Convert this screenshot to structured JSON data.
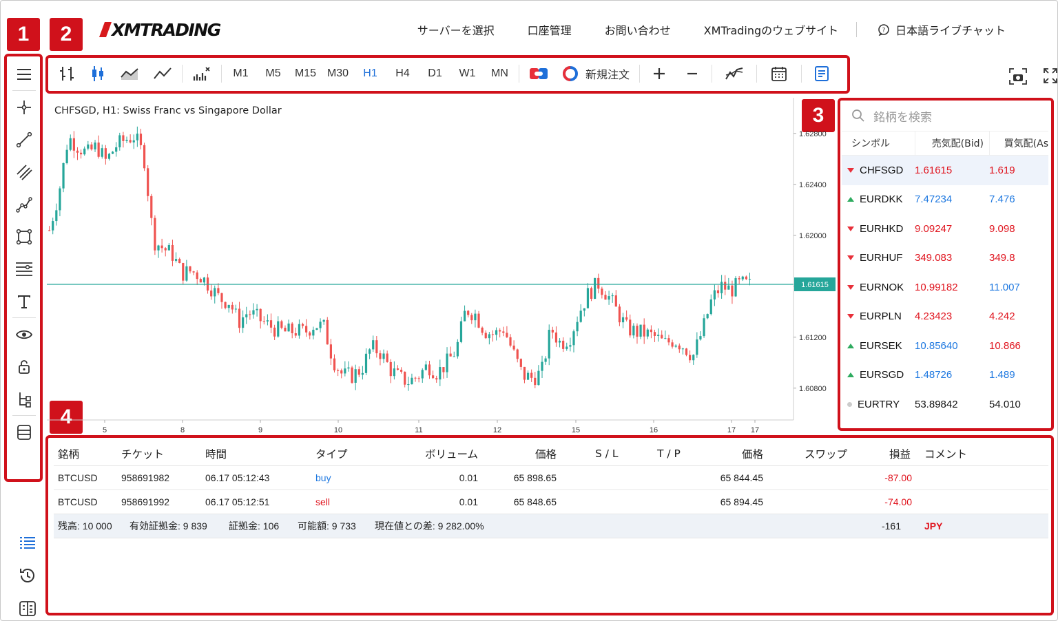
{
  "brand": {
    "logo_text": "XMTRADING",
    "accent": "#d0111b"
  },
  "nav": {
    "items": [
      "サーバーを選択",
      "口座管理",
      "お問い合わせ",
      "XMTradingのウェブサイト"
    ],
    "chat": "日本語ライブチャット"
  },
  "callouts": [
    "1",
    "2",
    "3",
    "4"
  ],
  "sidebar": {
    "tools": [
      "menu-icon",
      "crosshair-icon",
      "trend-line-icon",
      "parallel-channel-icon",
      "polyline-icon",
      "rectangle-icon",
      "fib-levels-icon",
      "text-icon",
      "visibility-icon",
      "lock-icon",
      "object-tree-icon",
      "layers-icon"
    ],
    "bottom": [
      "list-icon",
      "history-icon",
      "journal-icon"
    ]
  },
  "toolbar": {
    "chart_types": [
      "bars-icon",
      "candles-icon",
      "area-icon",
      "line-icon",
      "indicators-icon"
    ],
    "timeframes": [
      "M1",
      "M5",
      "M15",
      "M30",
      "H1",
      "H4",
      "D1",
      "W1",
      "MN"
    ],
    "active_timeframe": "H1",
    "new_order": "新規注文"
  },
  "chart": {
    "title": "CHFSGD, H1: Swiss Franc vs Singapore Dollar",
    "current_price": "1.61615"
  },
  "chart_data": {
    "type": "candlestick",
    "title": "CHFSGD, H1: Swiss Franc vs Singapore Dollar",
    "ylim": [
      1.6055,
      1.6308
    ],
    "y_ticks": [
      "1.62800",
      "1.62400",
      "1.62000",
      "1.61600",
      "1.61200",
      "1.60800"
    ],
    "x_ticks": [
      "5",
      "8",
      "9",
      "10",
      "11",
      "12",
      "15",
      "16",
      "17",
      "17"
    ],
    "current_price": 1.61615,
    "up_color": "#26a69a",
    "down_color": "#ef5350",
    "close_path": [
      1.6204,
      1.6233,
      1.6277,
      1.627,
      1.6264,
      1.627,
      1.6258,
      1.627,
      1.6275,
      1.6278,
      1.6262,
      1.6196,
      1.619,
      1.6185,
      1.617,
      1.6172,
      1.6168,
      1.616,
      1.615,
      1.6148,
      1.6132,
      1.614,
      1.6135,
      1.613,
      1.6126,
      1.6124,
      1.6125,
      1.6124,
      1.613,
      1.6128,
      1.6102,
      1.609,
      1.609,
      1.6095,
      1.6112,
      1.6108,
      1.6095,
      1.6088,
      1.6085,
      1.609,
      1.6098,
      1.6092,
      1.61,
      1.611,
      1.6142,
      1.6138,
      1.6125,
      1.6122,
      1.6127,
      1.6108,
      1.609,
      1.6088,
      1.6092,
      1.6127,
      1.6115,
      1.612,
      1.614,
      1.6155,
      1.6162,
      1.6153,
      1.614,
      1.6127,
      1.6124,
      1.6123,
      1.612,
      1.6115,
      1.6118,
      1.6113,
      1.6105,
      1.6125,
      1.615,
      1.616,
      1.6157,
      1.6162,
      1.6161
    ]
  },
  "watchlist": {
    "search_placeholder": "銘柄を検索",
    "headers": [
      "シンボル",
      "売気配(Bid)",
      "買気配(As"
    ],
    "rows": [
      {
        "symbol": "CHFSGD",
        "dir": "down",
        "bid": "1.61615",
        "bid_color": "red",
        "ask": "1.619",
        "ask_color": "red"
      },
      {
        "symbol": "EURDKK",
        "dir": "up",
        "bid": "7.47234",
        "bid_color": "blue",
        "ask": "7.476",
        "ask_color": "blue"
      },
      {
        "symbol": "EURHKD",
        "dir": "down",
        "bid": "9.09247",
        "bid_color": "red",
        "ask": "9.098",
        "ask_color": "red"
      },
      {
        "symbol": "EURHUF",
        "dir": "down",
        "bid": "349.083",
        "bid_color": "red",
        "ask": "349.8",
        "ask_color": "red"
      },
      {
        "symbol": "EURNOK",
        "dir": "down",
        "bid": "10.99182",
        "bid_color": "red",
        "ask": "11.007",
        "ask_color": "blue"
      },
      {
        "symbol": "EURPLN",
        "dir": "down",
        "bid": "4.23423",
        "bid_color": "red",
        "ask": "4.242",
        "ask_color": "red"
      },
      {
        "symbol": "EURSEK",
        "dir": "up",
        "bid": "10.85640",
        "bid_color": "blue",
        "ask": "10.866",
        "ask_color": "red"
      },
      {
        "symbol": "EURSGD",
        "dir": "up",
        "bid": "1.48726",
        "bid_color": "blue",
        "ask": "1.489",
        "ask_color": "blue"
      },
      {
        "symbol": "EURTRY",
        "dir": "flat",
        "bid": "53.89842",
        "bid_color": "black",
        "ask": "54.010",
        "ask_color": "black"
      }
    ]
  },
  "positions": {
    "headers": [
      "銘柄",
      "チケット",
      "時間",
      "タイプ",
      "ボリューム",
      "価格",
      "S / L",
      "T / P",
      "価格",
      "スワップ",
      "損益",
      "コメント"
    ],
    "rows": [
      {
        "symbol": "BTCUSD",
        "ticket": "958691982",
        "time": "06.17 05:12:43",
        "type": "buy",
        "volume": "0.01",
        "open_price": "65 898.65",
        "price": "65 844.45",
        "profit": "-87.00"
      },
      {
        "symbol": "BTCUSD",
        "ticket": "958691992",
        "time": "06.17 05:12:51",
        "type": "sell",
        "volume": "0.01",
        "open_price": "65 848.65",
        "price": "65 894.45",
        "profit": "-74.00"
      }
    ],
    "summary": {
      "balance": "残高: 10 000",
      "equity": "有効証拠金: 9 839",
      "margin": "証拠金: 106",
      "free_margin": "可能額: 9 733",
      "margin_level": "現在値との差: 9 282.00%",
      "total_profit": "-161",
      "currency": "JPY"
    }
  }
}
